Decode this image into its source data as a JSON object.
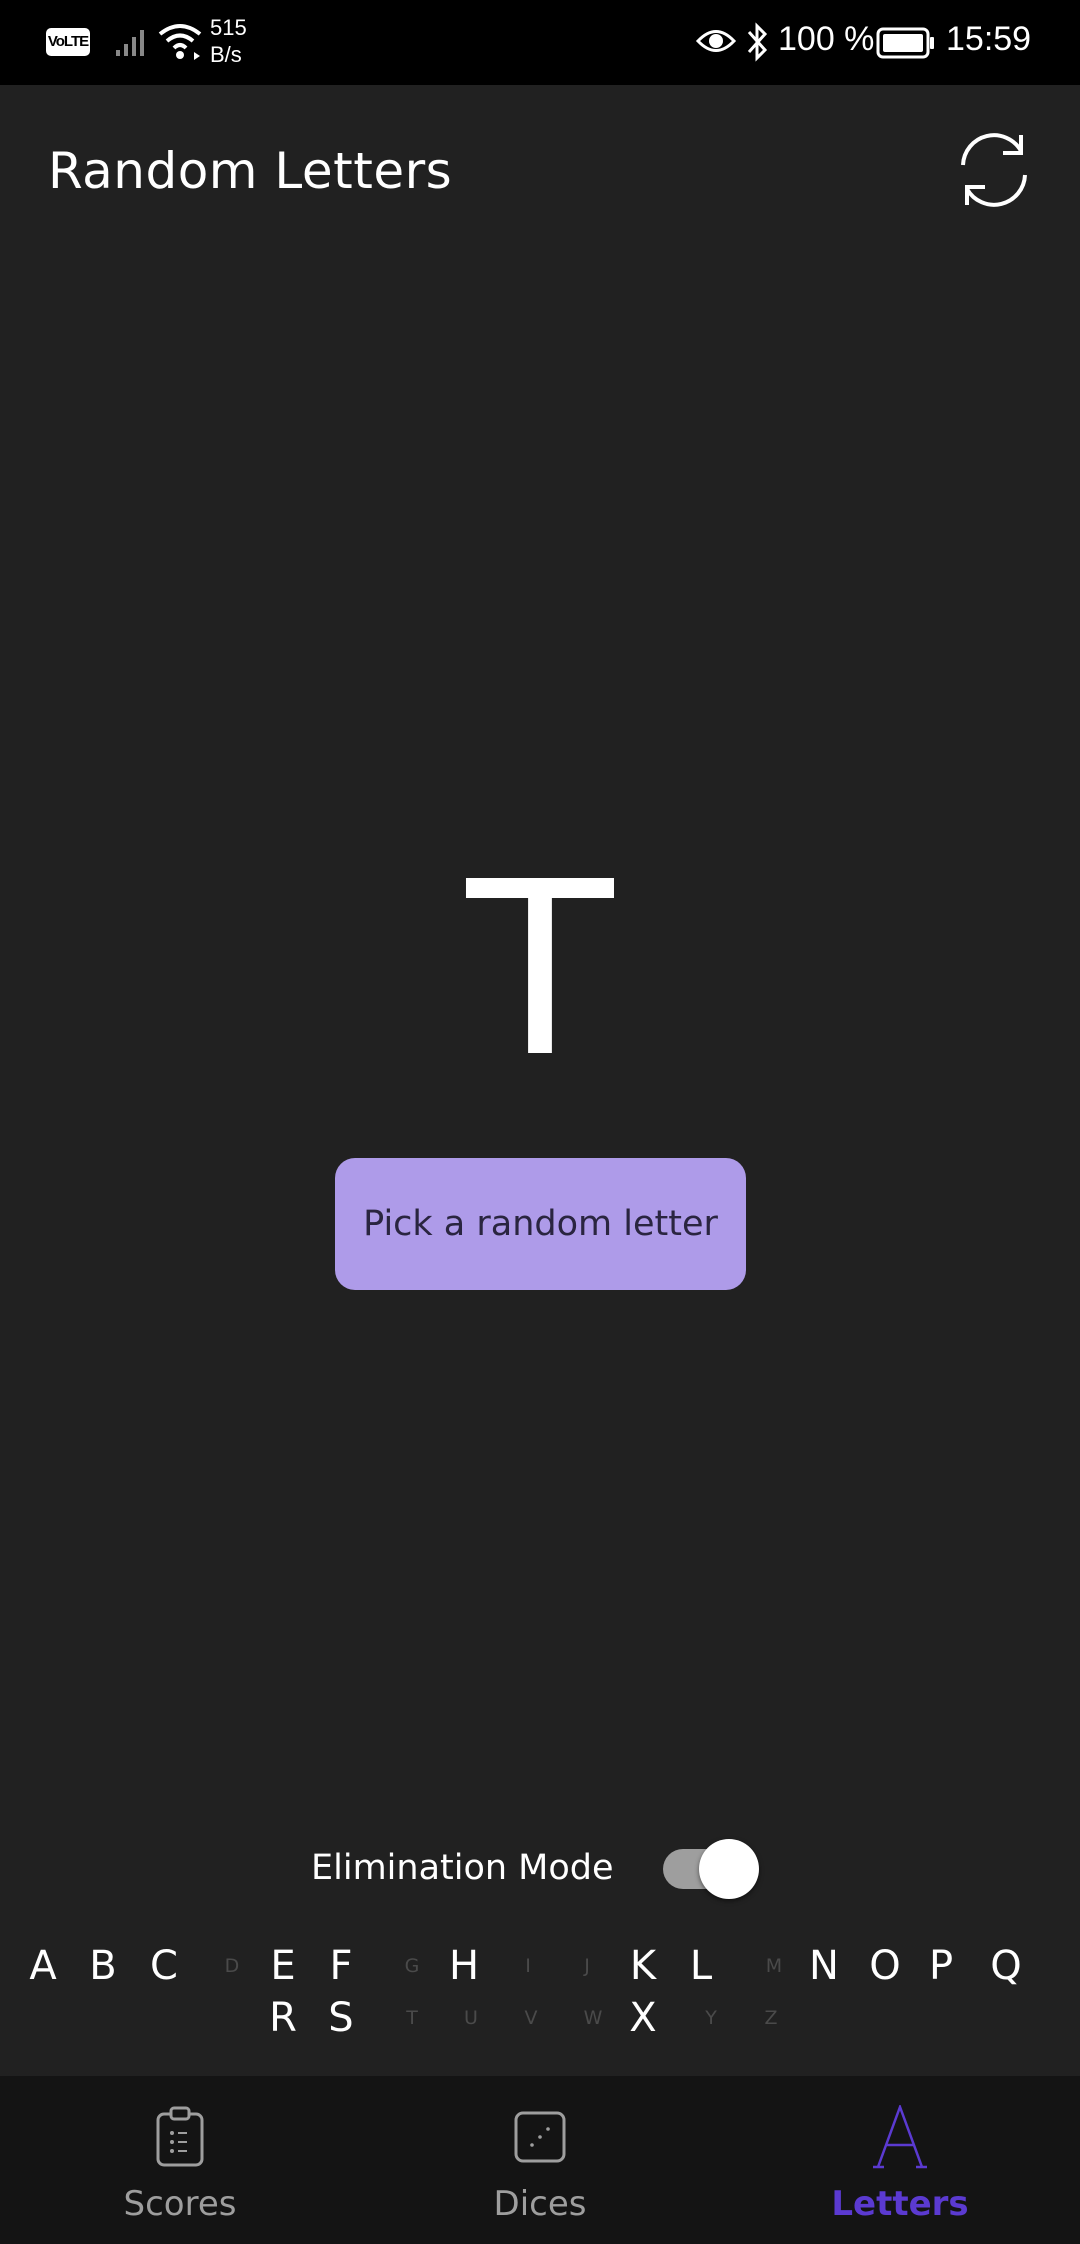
{
  "status_bar": {
    "volte": "VoLTE",
    "net_speed_value": "515",
    "net_speed_unit": "B/s",
    "battery_percent": "100 %",
    "time": "15:59"
  },
  "app_bar": {
    "title": "Random Letters",
    "refresh_icon": "refresh-icon"
  },
  "main": {
    "current_letter": "T",
    "pick_button_label": "Pick a random letter"
  },
  "elimination": {
    "label": "Elimination Mode",
    "enabled": true
  },
  "letters": [
    {
      "char": "A",
      "available": true
    },
    {
      "char": "B",
      "available": true
    },
    {
      "char": "C",
      "available": true
    },
    {
      "char": "D",
      "available": false
    },
    {
      "char": "E",
      "available": true
    },
    {
      "char": "F",
      "available": true
    },
    {
      "char": "G",
      "available": false
    },
    {
      "char": "H",
      "available": true
    },
    {
      "char": "I",
      "available": false
    },
    {
      "char": "J",
      "available": false
    },
    {
      "char": "K",
      "available": true
    },
    {
      "char": "L",
      "available": true
    },
    {
      "char": "M",
      "available": false
    },
    {
      "char": "N",
      "available": true
    },
    {
      "char": "O",
      "available": true
    },
    {
      "char": "P",
      "available": true
    },
    {
      "char": "Q",
      "available": true
    },
    {
      "char": "R",
      "available": true
    },
    {
      "char": "S",
      "available": true
    },
    {
      "char": "T",
      "available": false
    },
    {
      "char": "U",
      "available": false
    },
    {
      "char": "V",
      "available": false
    },
    {
      "char": "W",
      "available": false
    },
    {
      "char": "X",
      "available": true
    },
    {
      "char": "Y",
      "available": false
    },
    {
      "char": "Z",
      "available": false
    }
  ],
  "bottom_nav": {
    "items": [
      {
        "label": "Scores",
        "icon": "clipboard-icon",
        "active": false
      },
      {
        "label": "Dices",
        "icon": "die-icon",
        "active": false
      },
      {
        "label": "Letters",
        "icon": "letter-a-icon",
        "active": true
      }
    ],
    "active_color": "#5b3ad1"
  },
  "colors": {
    "background": "#212121",
    "button": "#ae9be9"
  }
}
